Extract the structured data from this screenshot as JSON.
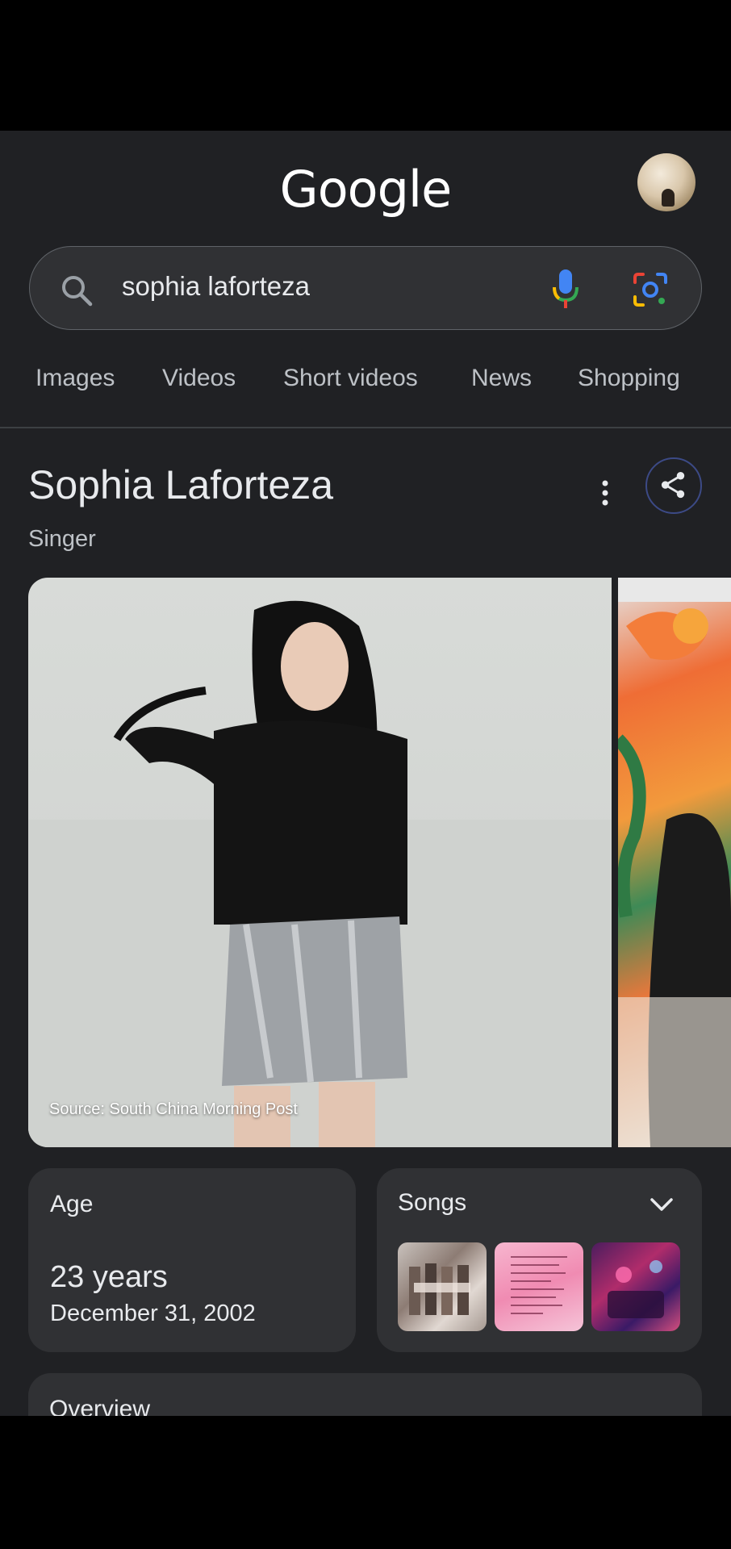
{
  "header": {
    "logo_text": "Google",
    "avatar_icon": "profile-avatar"
  },
  "search": {
    "query": "sophia laforteza",
    "search_icon": "search-icon",
    "mic_icon": "mic-icon",
    "lens_icon": "lens-icon"
  },
  "tabs": [
    {
      "label": "Images"
    },
    {
      "label": "Videos"
    },
    {
      "label": "Short videos"
    },
    {
      "label": "News"
    },
    {
      "label": "Shopping"
    }
  ],
  "knowledge_panel": {
    "title": "Sophia Laforteza",
    "subtitle": "Singer",
    "photo_caption": "Source: South China Morning Post",
    "age": {
      "label": "Age",
      "value": "23 years",
      "date": "December 31, 2002"
    },
    "songs": {
      "label": "Songs"
    },
    "overview": {
      "label": "Overview"
    }
  },
  "colors": {
    "background": "#202124",
    "card": "#303134",
    "text": "#e8eaed",
    "muted_text": "#bdc1c6",
    "share_ring": "#3c4a86"
  }
}
